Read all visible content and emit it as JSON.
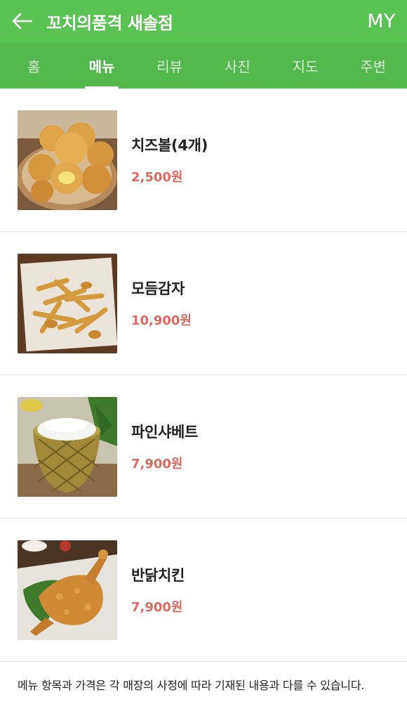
{
  "header": {
    "title": "꼬치의품격 새솔점",
    "my_label": "MY",
    "back_icon": "arrow-left-icon",
    "bg_color": "#5ac453"
  },
  "tabs": [
    {
      "label": "홈"
    },
    {
      "label": "메뉴",
      "active": true
    },
    {
      "label": "리뷰"
    },
    {
      "label": "사진"
    },
    {
      "label": "지도"
    },
    {
      "label": "주변"
    }
  ],
  "menu": [
    {
      "name": "치즈볼(4개)",
      "price": "2,500원",
      "image": "cheese-balls-photo"
    },
    {
      "name": "모듬감자",
      "price": "10,900원",
      "image": "assorted-fries-photo"
    },
    {
      "name": "파인샤베트",
      "price": "7,900원",
      "image": "pineapple-sherbet-photo"
    },
    {
      "name": "반닭치킨",
      "price": "7,900원",
      "image": "half-chicken-photo"
    }
  ],
  "notice": "메뉴 항목과 가격은 각 매장의 사정에 따라 기재된 내용과 다를 수 있습니다.",
  "colors": {
    "price": "#d96a64",
    "tab_bg": "#53b94c"
  }
}
